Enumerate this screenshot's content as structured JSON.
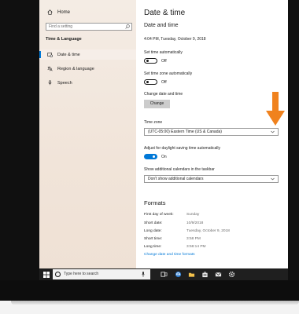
{
  "sidebar": {
    "home_label": "Home",
    "search_placeholder": "Find a setting",
    "section_title": "Time & Language",
    "items": [
      {
        "label": "Date & time",
        "icon": "calendar-clock-icon",
        "selected": true
      },
      {
        "label": "Region & language",
        "icon": "language-icon",
        "selected": false
      },
      {
        "label": "Speech",
        "icon": "microphone-icon",
        "selected": false
      }
    ]
  },
  "main": {
    "title": "Date & time",
    "subtitle": "Date and time",
    "current_datetime": "4:04 PM, Tuesday, October 9, 2018",
    "set_time_auto": {
      "label": "Set time automatically",
      "state": "Off"
    },
    "set_timezone_auto": {
      "label": "Set time zone automatically",
      "state": "Off"
    },
    "change_datetime": {
      "label": "Change date and time",
      "button": "Change"
    },
    "time_zone": {
      "label": "Time zone",
      "value": "(UTC-05:00) Eastern Time (US & Canada)"
    },
    "daylight": {
      "label": "Adjust for daylight saving time automatically",
      "state": "On"
    },
    "calendars": {
      "label": "Show additional calendars in the taskbar",
      "value": "Don't show additional calendars"
    },
    "formats": {
      "title": "Formats",
      "rows": [
        {
          "key": "First day of week:",
          "value": "Sunday"
        },
        {
          "key": "Short date:",
          "value": "10/9/2018"
        },
        {
          "key": "Long date:",
          "value": "Tuesday, October 9, 2018"
        },
        {
          "key": "Short time:",
          "value": "3:58 PM"
        },
        {
          "key": "Long time:",
          "value": "3:58:14 PM"
        }
      ],
      "link": "Change date and time formats"
    }
  },
  "taskbar": {
    "search_placeholder": "Type here to search"
  },
  "colors": {
    "accent": "#0078d7",
    "arrow": "#f0821e",
    "taskbar": "#1f1f1f"
  }
}
